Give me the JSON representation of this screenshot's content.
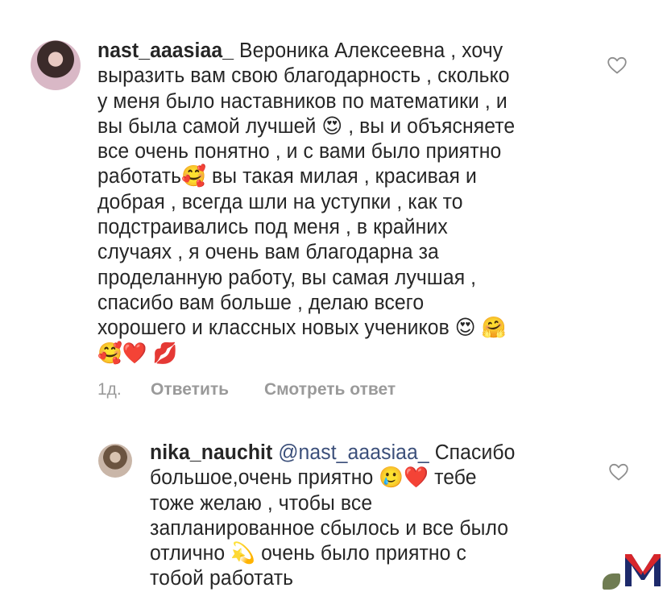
{
  "comment": {
    "username": "nast_aaasiaa_",
    "lines": [
      "Вероника Алексеевна , хочу",
      "выразить вам свою благодарность , сколько",
      "у меня было наставников по математики , и",
      "вы была самой лучшей 😍 , вы и объясняете",
      "все очень понятно , и с вами было приятно",
      "работать🥰 вы такая милая , красивая и",
      "добрая , всегда шли на уступки , как то",
      "подстраивались под меня , в крайних",
      "случаях , я очень вам благодарна за",
      "проделанную работу, вы самая лучшая ,",
      "спасибо вам больше , делаю всего",
      "хорошего и классных новых учеников 😍 🤗",
      "🥰❤️ 💋"
    ],
    "time": "1д.",
    "reply_label": "Ответить",
    "view_reply_label": "Смотреть ответ"
  },
  "reply": {
    "username": "nika_nauchit",
    "mention": "@nast_aaasiaa_",
    "lines": [
      "Спасибо",
      "большое,очень приятно 🥲❤️ тебе",
      "тоже желаю , чтобы все",
      "запланированное сбылось и все было",
      "отлично 💫 очень было приятно с",
      "тобой работать"
    ]
  },
  "icons": {
    "like": "heart-outline-icon",
    "logo": "m-logo"
  },
  "colors": {
    "text": "#262626",
    "meta": "#9a9a9a",
    "mention": "#3b4f7a",
    "logo_red": "#d7262b",
    "logo_blue": "#1d2a6b"
  }
}
